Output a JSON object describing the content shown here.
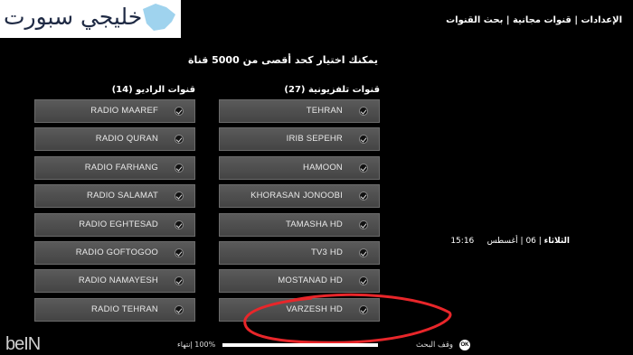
{
  "watermark": {
    "text": "خليجي سبورت"
  },
  "breadcrumb": "الإعدادات | قنوات مجانية | بحث القنوات",
  "info": "يمكنك اختيار كحد أقصى من 5000 قناة",
  "tv": {
    "title": "قنوات تلفزيونية (27)",
    "items": [
      {
        "label": "TEHRAN"
      },
      {
        "label": "IRIB SEPEHR"
      },
      {
        "label": "HAMOON"
      },
      {
        "label": "KHORASAN JONOOBI"
      },
      {
        "label": "TAMASHA HD"
      },
      {
        "label": "TV3 HD"
      },
      {
        "label": "MOSTANAD HD"
      },
      {
        "label": "VARZESH HD"
      }
    ]
  },
  "radio": {
    "title": "قنوات الراديو (14)",
    "items": [
      {
        "label": "RADIO MAAREF"
      },
      {
        "label": "RADIO QURAN"
      },
      {
        "label": "RADIO FARHANG"
      },
      {
        "label": "RADIO SALAMAT"
      },
      {
        "label": "RADIO EGHTESAD"
      },
      {
        "label": "RADIO GOFTOGOO"
      },
      {
        "label": "RADIO NAMAYESH"
      },
      {
        "label": "RADIO TEHRAN"
      }
    ]
  },
  "datetime": {
    "day": "الثلاثاء",
    "date": "06 | أغسطس",
    "time": "15:16"
  },
  "progress": {
    "percent": 100,
    "label": "100% إنتهاء"
  },
  "footer": {
    "stop_label": "وقف البحث",
    "ok": "OK",
    "brand": "beIN"
  },
  "colors": {
    "annotation": "#e8262a",
    "item_bg": "#4d4d4d"
  }
}
